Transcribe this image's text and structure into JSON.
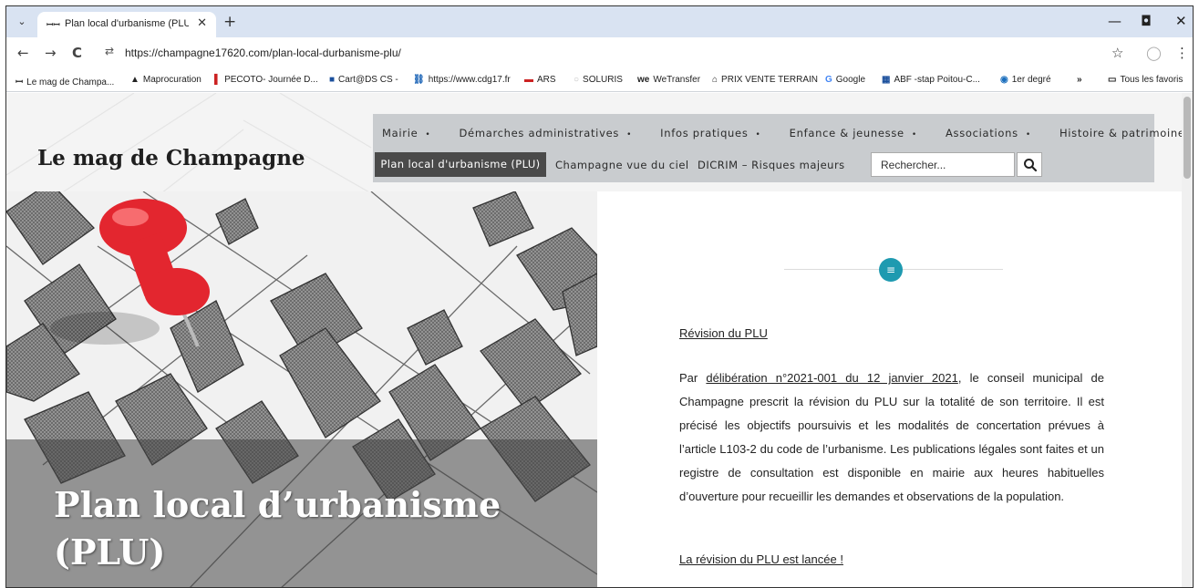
{
  "browser": {
    "tab_title": "Plan local d'urbanisme (PLU) - |",
    "url": "https://champagne17620.com/plan-local-durbanisme-plu/",
    "bookmarks": [
      {
        "icon": "ꟷ",
        "label": "Le mag de Champa..."
      },
      {
        "icon": "▲",
        "label": "Maprocuration"
      },
      {
        "icon": "▌",
        "label": "PECOTO- Journée D..."
      },
      {
        "icon": "■",
        "label": "Cart@DS CS -"
      },
      {
        "icon": "⛓",
        "label": "https://www.cdg17.fr"
      },
      {
        "icon": "▬",
        "label": "ARS"
      },
      {
        "icon": "○",
        "label": "SOLURIS"
      },
      {
        "icon": "we",
        "label": "WeTransfer"
      },
      {
        "icon": "⌂",
        "label": "PRIX VENTE TERRAIN"
      },
      {
        "icon": "G",
        "label": "Google"
      },
      {
        "icon": "▦",
        "label": "ABF -stap Poitou-C..."
      },
      {
        "icon": "◉",
        "label": "1er degré"
      }
    ],
    "bookmarks_more": "»",
    "all_bookmarks": "Tous les favoris"
  },
  "site": {
    "title": "Le mag de Champagne",
    "menu_primary": [
      {
        "label": "Mairie"
      },
      {
        "label": "Démarches administratives"
      },
      {
        "label": "Infos pratiques"
      },
      {
        "label": "Enfance & jeunesse"
      },
      {
        "label": "Associations"
      },
      {
        "label": "Histoire & patrimoine"
      }
    ],
    "menu_secondary": {
      "active": "Plan local d'urbanisme (PLU)",
      "link1": "Champagne vue du ciel",
      "link2": "DICRIM – Risques majeurs"
    },
    "search_placeholder": "Rechercher..."
  },
  "hero": {
    "title": "Plan local d’urbanisme (PLU)"
  },
  "article": {
    "section_heading": "Révision du PLU",
    "para_prefix": "Par ",
    "para_link": "délibération n°2021-001 du 12 janvier 2021",
    "para_rest": ", le conseil municipal de Champagne prescrit la révision du PLU sur la totalité de son territoire. Il est précisé les objectifs poursuivis et les modalités de concertation prévues à l’article L103-2 du code de l’urbanisme. Les publications légales sont faites et un registre de consultation est disponible en mairie aux heures habituelles d’ouverture pour recueillir les demandes et observations de la population.",
    "link_revision": "La révision du PLU est lancée !"
  },
  "colors": {
    "tabstrip": "#d9e3f2",
    "nav_panel": "#c9cccf",
    "nav_active": "#4a4a4a",
    "badge": "#1e9ab0",
    "pin": "#e3262f"
  },
  "icons": {
    "back": "←",
    "forward": "→",
    "reload": "C",
    "star": "☆",
    "profile": "◯",
    "menu": "⋮",
    "minimize": "—",
    "maximize": "◘",
    "close": "✕",
    "new_tab": "+",
    "tab_close": "✕",
    "tab_list": "⌄",
    "search": "⚲",
    "doc": "≡"
  }
}
